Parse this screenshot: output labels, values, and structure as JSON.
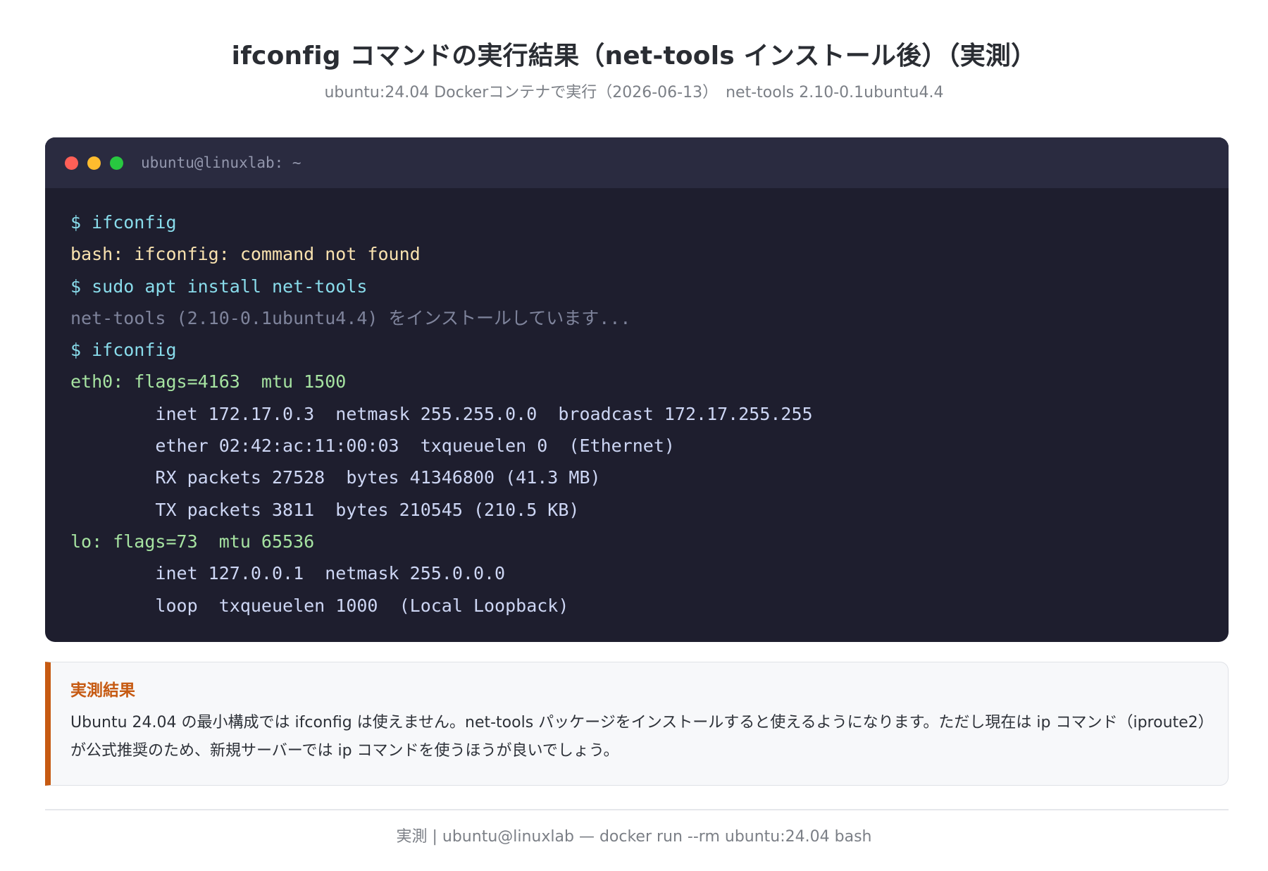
{
  "header": {
    "title": "ifconfig コマンドの実行結果（net-tools インストール後）（実測）",
    "subtitle": "ubuntu:24.04 Dockerコンテナで実行（2026-06-13）　net-tools 2.10-0.1ubuntu4.4"
  },
  "terminal": {
    "window_title": "ubuntu@linuxlab: ~",
    "lines": [
      {
        "kind": "cmd",
        "text": "$ ifconfig"
      },
      {
        "kind": "err",
        "text": "bash: ifconfig: command not found"
      },
      {
        "kind": "cmd",
        "text": "$ sudo apt install net-tools"
      },
      {
        "kind": "dim",
        "text": "net-tools (2.10-0.1ubuntu4.4) をインストールしています..."
      },
      {
        "kind": "cmd",
        "text": "$ ifconfig"
      },
      {
        "kind": "iface",
        "text": "eth0: flags=4163  mtu 1500"
      },
      {
        "kind": "info",
        "text": "        inet 172.17.0.3  netmask 255.255.0.0  broadcast 172.17.255.255"
      },
      {
        "kind": "info",
        "text": "        ether 02:42:ac:11:00:03  txqueuelen 0  (Ethernet)"
      },
      {
        "kind": "info",
        "text": "        RX packets 27528  bytes 41346800 (41.3 MB)"
      },
      {
        "kind": "info",
        "text": "        TX packets 3811  bytes 210545 (210.5 KB)"
      },
      {
        "kind": "iface",
        "text": "lo: flags=73  mtu 65536"
      },
      {
        "kind": "info",
        "text": "        inet 127.0.0.1  netmask 255.0.0.0"
      },
      {
        "kind": "info",
        "text": "        loop  txqueuelen 1000  (Local Loopback)"
      }
    ]
  },
  "note": {
    "title": "実測結果",
    "text": "Ubuntu 24.04 の最小構成では ifconfig は使えません。net-tools パッケージをインストールすると使えるようになります。ただし現在は ip コマンド（iproute2）が公式推奨のため、新規サーバーでは ip コマンドを使うほうが良いでしょう。"
  },
  "footer": {
    "text": "実測 | ubuntu@linuxlab — docker run --rm ubuntu:24.04 bash"
  },
  "colors": {
    "terminal_bg": "#1e1e2e",
    "titlebar_bg": "#2a2b40",
    "command": "#89dceb",
    "error": "#f9e2af",
    "dim": "#7f849c",
    "interface": "#a6e3a1",
    "accent": "#c65a12"
  }
}
